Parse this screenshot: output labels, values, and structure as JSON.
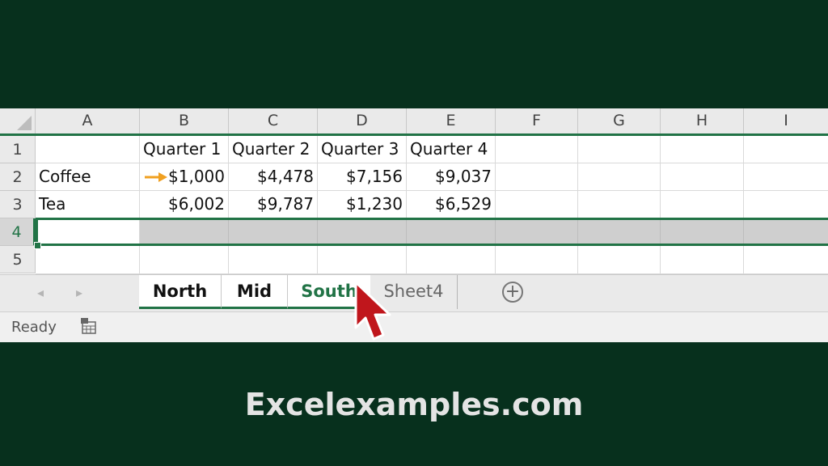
{
  "columns": [
    "A",
    "B",
    "C",
    "D",
    "E",
    "F",
    "G",
    "H",
    "I"
  ],
  "rows": [
    "1",
    "2",
    "3",
    "4",
    "5"
  ],
  "cells": {
    "b1": "Quarter 1",
    "c1": "Quarter 2",
    "d1": "Quarter 3",
    "e1": "Quarter 4",
    "a2": "Coffee",
    "b2": "$1,000",
    "c2": "$4,478",
    "d2": "$7,156",
    "e2": "$9,037",
    "a3": "Tea",
    "b3": "$6,002",
    "c3": "$9,787",
    "d3": "$1,230",
    "e3": "$6,529"
  },
  "sheet_tabs": {
    "prev": "◂",
    "next": "▸",
    "tabs": [
      "North",
      "Mid",
      "South",
      "Sheet4"
    ],
    "active": "South",
    "add": "+"
  },
  "status": {
    "text": "Ready"
  },
  "colors": {
    "accent": "#217346",
    "background": "#07301d",
    "arrow": "#f0a020",
    "cursor": "#c0161c"
  },
  "icons": {
    "arrow": "right-arrow-icon",
    "cursor": "mouse-pointer-icon",
    "macro": "macro-record-icon"
  },
  "footer": "Excelexamples.com"
}
